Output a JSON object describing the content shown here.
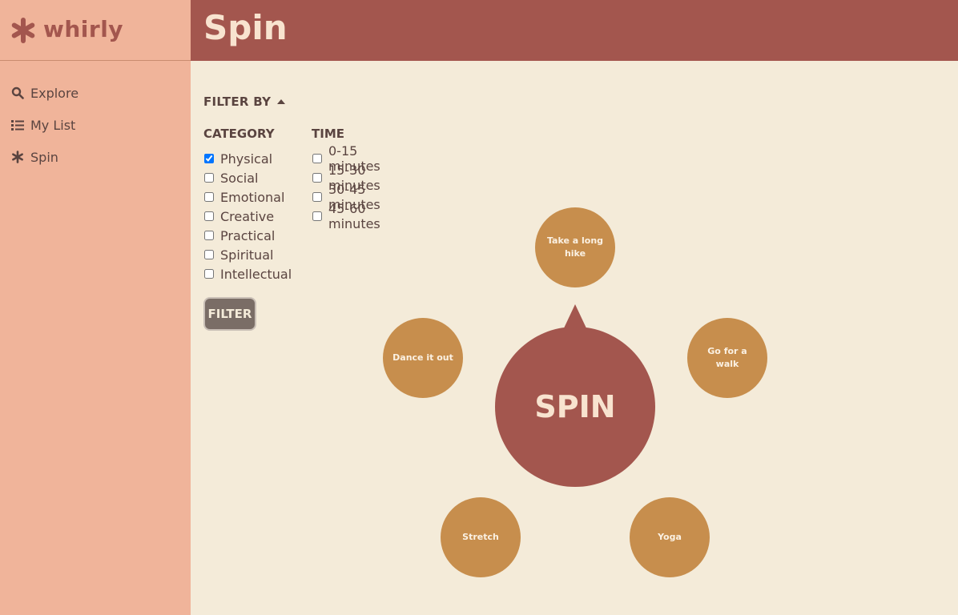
{
  "brand": {
    "name": "whirly"
  },
  "sidebar": {
    "items": [
      {
        "label": "Explore",
        "icon": "search-icon"
      },
      {
        "label": "My List",
        "icon": "list-icon"
      },
      {
        "label": "Spin",
        "icon": "asterisk-icon"
      }
    ]
  },
  "header": {
    "title": "Spin"
  },
  "filters": {
    "toggle_label": "FILTER BY",
    "category": {
      "heading": "CATEGORY",
      "options": [
        {
          "label": "Physical",
          "checked": true
        },
        {
          "label": "Social",
          "checked": false
        },
        {
          "label": "Emotional",
          "checked": false
        },
        {
          "label": "Creative",
          "checked": false
        },
        {
          "label": "Practical",
          "checked": false
        },
        {
          "label": "Spiritual",
          "checked": false
        },
        {
          "label": "Intellectual",
          "checked": false
        }
      ]
    },
    "time": {
      "heading": "TIME",
      "options": [
        {
          "label": "0-15 minutes",
          "checked": false
        },
        {
          "label": "15-30 minutes",
          "checked": false
        },
        {
          "label": "30-45 minutes",
          "checked": false
        },
        {
          "label": "45-60 minutes",
          "checked": false
        }
      ]
    },
    "button_label": "FILTER"
  },
  "spinner": {
    "center_label": "SPIN",
    "activities": [
      "Take a long hike",
      "Go for a walk",
      "Yoga",
      "Stretch",
      "Dance it out"
    ]
  },
  "colors": {
    "sidebar": "#f0b49a",
    "header": "#a3564e",
    "background": "#f4ebd9",
    "bubble": "#c78e4d"
  }
}
